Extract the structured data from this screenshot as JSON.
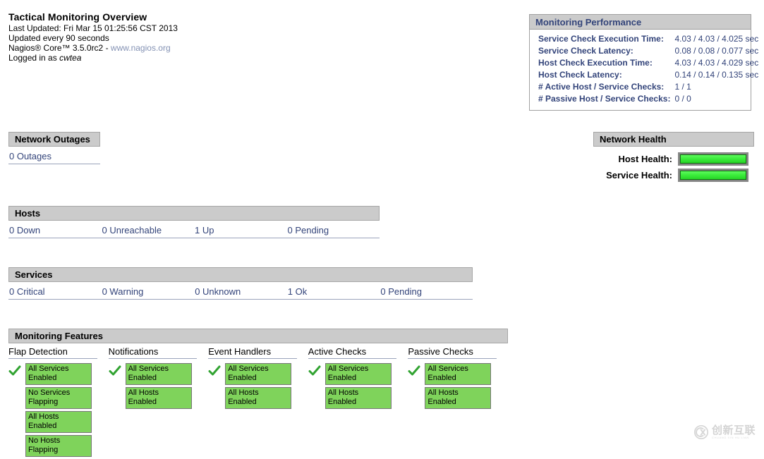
{
  "info": {
    "title": "Tactical Monitoring Overview",
    "last_updated": "Last Updated: Fri Mar 15 01:25:56 CST 2013",
    "update_interval": "Updated every 90 seconds",
    "version_prefix": "Nagios® Core™ 3.5.0rc2 - ",
    "url": "www.nagios.org",
    "logged_in_prefix": "Logged in as ",
    "logged_in_user": "cwtea"
  },
  "performance": {
    "title": "Monitoring Performance",
    "rows": [
      {
        "label": "Service Check Execution Time:",
        "value": "4.03 / 4.03 / 4.025 sec"
      },
      {
        "label": "Service Check Latency:",
        "value": "0.08 / 0.08 / 0.077 sec"
      },
      {
        "label": "Host Check Execution Time:",
        "value": "4.03 / 4.03 / 4.029 sec"
      },
      {
        "label": "Host Check Latency:",
        "value": "0.14 / 0.14 / 0.135 sec"
      },
      {
        "label": "# Active Host / Service Checks:",
        "value": "1 / 1"
      },
      {
        "label": "# Passive Host / Service Checks:",
        "value": "0 / 0"
      }
    ]
  },
  "outages": {
    "title": "Network Outages",
    "count_label": "0 Outages"
  },
  "health": {
    "title": "Network Health",
    "host_label": "Host Health:",
    "service_label": "Service Health:",
    "host_percent": 100,
    "service_percent": 100,
    "bar_color": "#3ded3d"
  },
  "hosts": {
    "title": "Hosts",
    "cells": [
      {
        "label": "0 Down"
      },
      {
        "label": "0 Unreachable"
      },
      {
        "label": "1 Up"
      },
      {
        "label": "0 Pending"
      }
    ]
  },
  "services": {
    "title": "Services",
    "cells": [
      {
        "label": "0 Critical"
      },
      {
        "label": "0 Warning"
      },
      {
        "label": "0 Unknown"
      },
      {
        "label": "1 Ok"
      },
      {
        "label": "0 Pending"
      }
    ]
  },
  "features": {
    "title": "Monitoring Features",
    "columns": [
      {
        "head": "Flap Detection",
        "icon": "green-check-icon",
        "badges": [
          "All Services Enabled",
          "No Services Flapping",
          "All Hosts Enabled",
          "No Hosts Flapping"
        ]
      },
      {
        "head": "Notifications",
        "icon": "green-check-icon",
        "badges": [
          "All Services Enabled",
          "All Hosts Enabled"
        ]
      },
      {
        "head": "Event Handlers",
        "icon": "green-check-icon",
        "badges": [
          "All Services Enabled",
          "All Hosts Enabled"
        ]
      },
      {
        "head": "Active Checks",
        "icon": "green-check-icon",
        "badges": [
          "All Services Enabled",
          "All Hosts Enabled"
        ]
      },
      {
        "head": "Passive Checks",
        "icon": "green-check-icon",
        "badges": [
          "All Services Enabled",
          "All Hosts Enabled"
        ]
      }
    ]
  },
  "watermark": {
    "cn": "创新互联",
    "pinyin": "CHUANG XIN HU LIAN",
    "logo": "cx-logo-icon"
  }
}
